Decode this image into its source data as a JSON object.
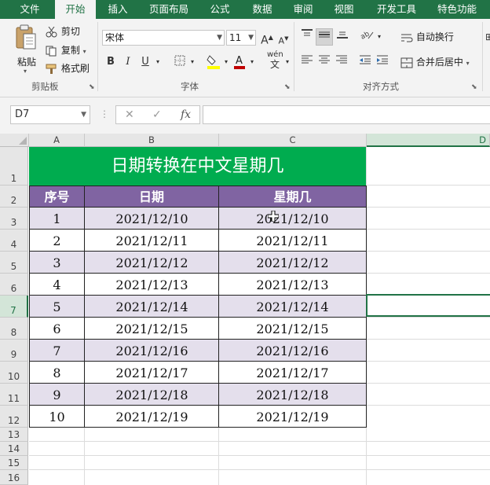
{
  "tabs": [
    "文件",
    "开始",
    "插入",
    "页面布局",
    "公式",
    "数据",
    "审阅",
    "视图",
    "开发工具",
    "特色功能"
  ],
  "active_tab": "开始",
  "clipboard": {
    "paste": "粘贴",
    "cut": "剪切",
    "copy": "复制",
    "format_painter": "格式刷",
    "group_label": "剪贴板"
  },
  "font": {
    "name": "宋体",
    "size": "11",
    "bold": "B",
    "italic": "I",
    "underline": "U",
    "group_label": "字体",
    "grow": "A",
    "shrink": "A",
    "wen": "wén"
  },
  "alignment": {
    "wrap_text": "自动换行",
    "merge_center": "合并后居中",
    "group_label": "对齐方式"
  },
  "name_box": "D7",
  "formula_bar": {
    "cancel": "✕",
    "enter": "✓",
    "fx": "fx",
    "content": ""
  },
  "columns": [
    "A",
    "B",
    "C",
    "D"
  ],
  "selected_column": "D",
  "rows": [
    "1",
    "2",
    "3",
    "4",
    "5",
    "6",
    "7",
    "8",
    "9",
    "10",
    "11",
    "12",
    "13",
    "14",
    "15",
    "16"
  ],
  "selected_row": "7",
  "sheet": {
    "title": "日期转换在中文星期几",
    "headers": [
      "序号",
      "日期",
      "星期几"
    ],
    "data": [
      [
        "1",
        "2021/12/10",
        "2021/12/10"
      ],
      [
        "2",
        "2021/12/11",
        "2021/12/11"
      ],
      [
        "3",
        "2021/12/12",
        "2021/12/12"
      ],
      [
        "4",
        "2021/12/13",
        "2021/12/13"
      ],
      [
        "5",
        "2021/12/14",
        "2021/12/14"
      ],
      [
        "6",
        "2021/12/15",
        "2021/12/15"
      ],
      [
        "7",
        "2021/12/16",
        "2021/12/16"
      ],
      [
        "8",
        "2021/12/17",
        "2021/12/17"
      ],
      [
        "9",
        "2021/12/18",
        "2021/12/18"
      ],
      [
        "10",
        "2021/12/19",
        "2021/12/19"
      ]
    ]
  },
  "colors": {
    "ribbon_green": "#217346",
    "title_fill": "#00ac4f",
    "header_fill": "#8064a2",
    "band_fill": "#e4dfec"
  }
}
